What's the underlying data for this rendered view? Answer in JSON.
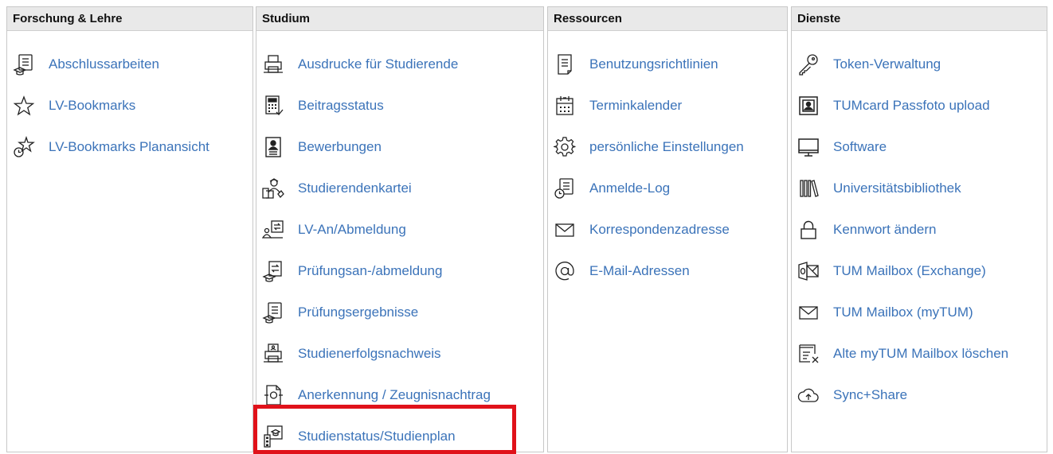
{
  "columns": [
    {
      "title": "Forschung & Lehre",
      "items": [
        {
          "label": "Abschlussarbeiten",
          "icon": "thesis-icon"
        },
        {
          "label": "LV-Bookmarks",
          "icon": "star-icon"
        },
        {
          "label": "LV-Bookmarks Planansicht",
          "icon": "star-clock-icon"
        }
      ]
    },
    {
      "title": "Studium",
      "items": [
        {
          "label": "Ausdrucke für Studierende",
          "icon": "printer-icon"
        },
        {
          "label": "Beitragsstatus",
          "icon": "calculator-icon"
        },
        {
          "label": "Bewerbungen",
          "icon": "application-icon"
        },
        {
          "label": "Studierendenkartei",
          "icon": "student-file-icon"
        },
        {
          "label": "LV-An/Abmeldung",
          "icon": "course-registration-icon"
        },
        {
          "label": "Prüfungsan-/abmeldung",
          "icon": "exam-registration-icon"
        },
        {
          "label": "Prüfungsergebnisse",
          "icon": "exam-results-icon"
        },
        {
          "label": "Studienerfolgsnachweis",
          "icon": "transcript-printer-icon"
        },
        {
          "label": "Anerkennung / Zeugnisnachtrag",
          "icon": "recognition-icon"
        },
        {
          "label": "Studienstatus/Studienplan",
          "icon": "study-plan-icon"
        }
      ]
    },
    {
      "title": "Ressourcen",
      "items": [
        {
          "label": "Benutzungsrichtlinien",
          "icon": "document-icon"
        },
        {
          "label": "Terminkalender",
          "icon": "calendar-icon"
        },
        {
          "label": "persönliche Einstellungen",
          "icon": "gear-icon"
        },
        {
          "label": "Anmelde-Log",
          "icon": "login-log-icon"
        },
        {
          "label": "Korrespondenzadresse",
          "icon": "envelope-icon"
        },
        {
          "label": "E-Mail-Adressen",
          "icon": "at-sign-icon"
        }
      ]
    },
    {
      "title": "Dienste",
      "items": [
        {
          "label": "Token-Verwaltung",
          "icon": "key-icon"
        },
        {
          "label": "TUMcard Passfoto upload",
          "icon": "id-photo-icon"
        },
        {
          "label": "Software",
          "icon": "monitor-icon"
        },
        {
          "label": "Universitätsbibliothek",
          "icon": "library-books-icon"
        },
        {
          "label": "Kennwort ändern",
          "icon": "lock-icon"
        },
        {
          "label": "TUM Mailbox (Exchange)",
          "icon": "exchange-mailbox-icon"
        },
        {
          "label": "TUM Mailbox (myTUM)",
          "icon": "envelope-icon"
        },
        {
          "label": "Alte myTUM Mailbox löschen",
          "icon": "delete-mailbox-icon"
        },
        {
          "label": "Sync+Share",
          "icon": "cloud-upload-icon"
        }
      ]
    }
  ],
  "colors": {
    "link": "#3b73b9",
    "header_bg": "#e9e9e9",
    "highlight": "#e0121a"
  }
}
